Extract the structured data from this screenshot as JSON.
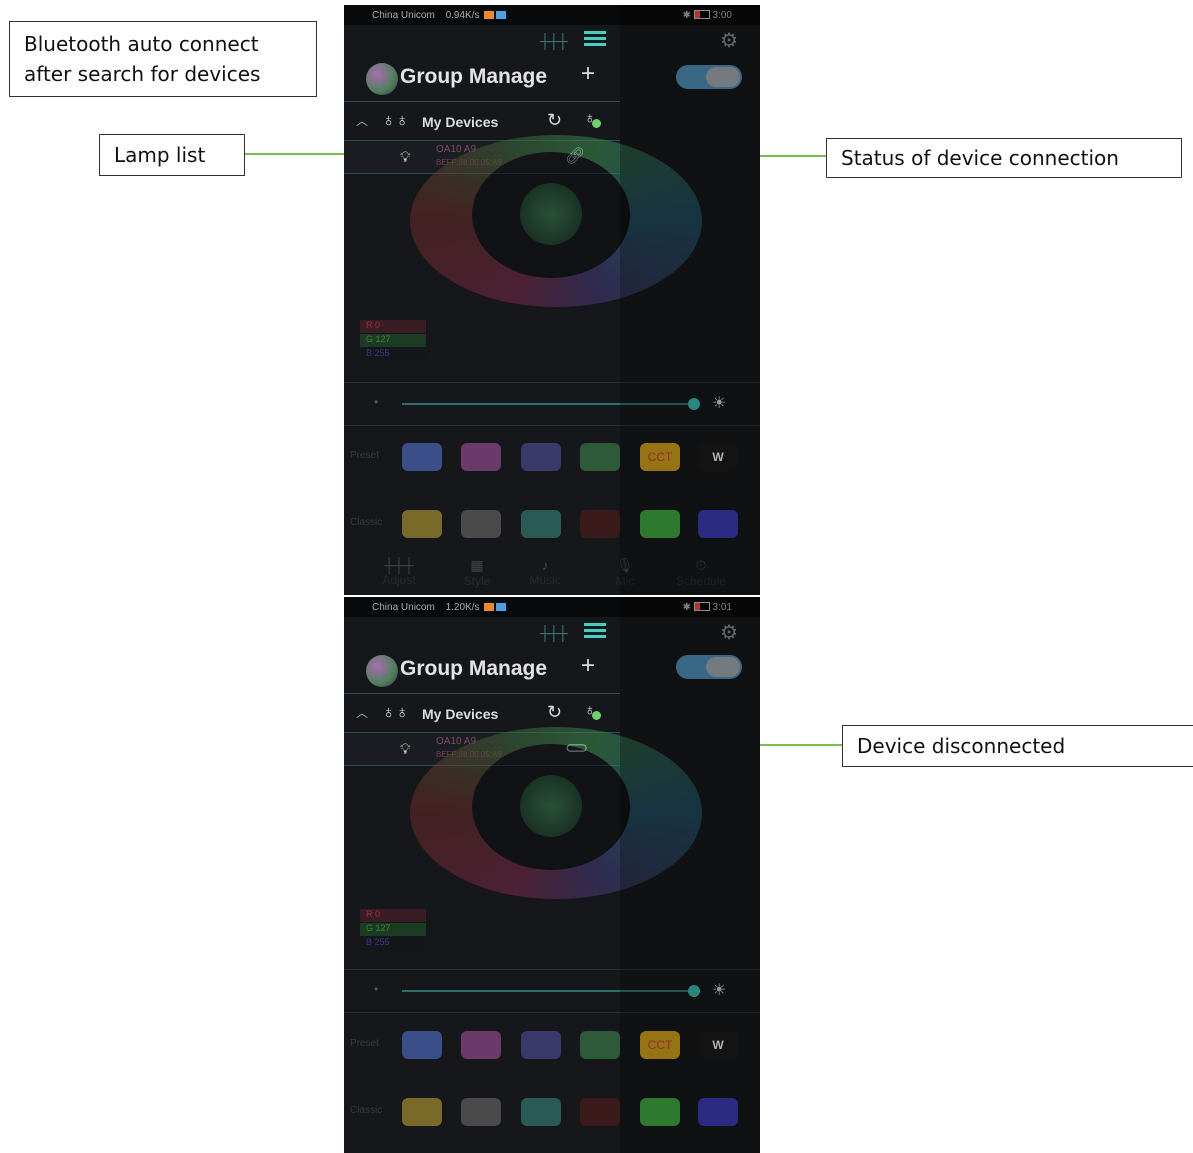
{
  "callouts": {
    "bluetooth_line1": "Bluetooth auto connect",
    "bluetooth_line2": "after search for devices",
    "lamp_list": "Lamp list",
    "status": "Status of device connection",
    "disconnected": "Device disconnected"
  },
  "phones": [
    {
      "status_bar": {
        "carrier": "China Unicom",
        "speed": "0.94K/s",
        "time": "3:00"
      },
      "group_title": "Group Manage",
      "add_label": "+",
      "section_title": "My Devices",
      "device": {
        "name": "OA10 A9",
        "mac": "BEFF:68:00:05:A9",
        "connection": "connected",
        "link_icon": "link-icon"
      },
      "rgb": {
        "r": "R 0",
        "g": "G 127",
        "b": "B 255"
      },
      "presets_label": "Preset",
      "classic_label": "Classic",
      "cct_label": "CCT",
      "w_label": "W",
      "nav": [
        "Adjust",
        "Style",
        "Music",
        "Mic",
        "Schedule"
      ]
    },
    {
      "status_bar": {
        "carrier": "China Unicom",
        "speed": "1.20K/s",
        "time": "3:01"
      },
      "group_title": "Group Manage",
      "add_label": "+",
      "section_title": "My Devices",
      "device": {
        "name": "OA10 A9",
        "mac": "BEFF:68:00:05:A9",
        "connection": "disconnected",
        "link_icon": "broken-link-icon"
      },
      "rgb": {
        "r": "R 0",
        "g": "G 127",
        "b": "B 255"
      },
      "presets_label": "Preset",
      "classic_label": "Classic",
      "cct_label": "CCT",
      "w_label": "W"
    }
  ],
  "colors": {
    "accent": "#3fd1c1",
    "arrow": "#7cc04b",
    "toggle": "#4c8bb4",
    "swatches_preset": [
      "#3a4f8a",
      "#6a3a6a",
      "#3a3a6a",
      "#2e5a3a",
      "#c89a1a",
      "#1a1a1a"
    ],
    "swatches_classic": [
      "#7a6a2a",
      "#4a4a4a",
      "#2a5a55",
      "#3a1a1a",
      "#3da23d",
      "#3a3ab0"
    ]
  }
}
